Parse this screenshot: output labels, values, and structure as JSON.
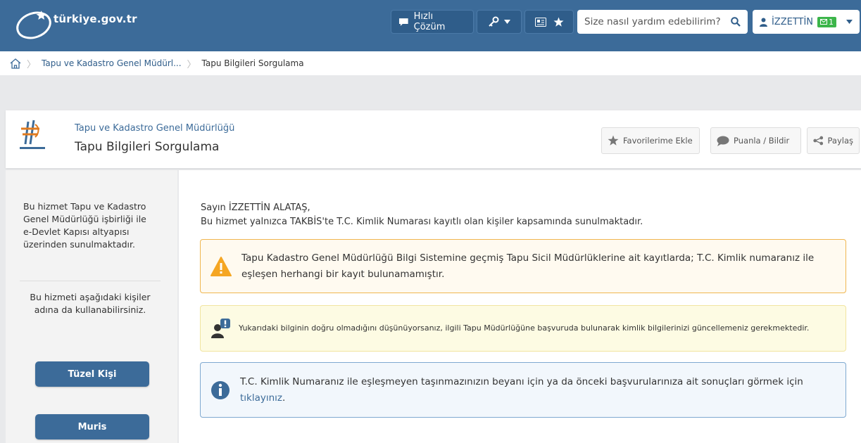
{
  "header": {
    "logo_text": "türkiye.gov.tr",
    "quick_solution_label": "Hızlı Çözüm",
    "search_placeholder": "Size nasıl yardım edebilirim?",
    "user_name": "İZZETTİN",
    "mail_count": "1"
  },
  "breadcrumb": {
    "items": [
      "Tapu ve Kadastro Genel Müdürl...",
      "Tapu Bilgileri Sorgulama"
    ]
  },
  "title_card": {
    "institution": "Tapu ve Kadastro Genel Müdürlüğü",
    "page_title": "Tapu Bilgileri Sorgulama",
    "actions": [
      "Favorilerime Ekle",
      "Puanla / Bildir",
      "Paylaş"
    ]
  },
  "sidebar": {
    "info_text": "Bu hizmet Tapu ve Kadastro Genel Müdürlüğü işbirliği ile e-Devlet Kapısı altyapısı üzerinden sunulmaktadır.",
    "others_text": "Bu hizmeti aşağıdaki kişiler adına da kullanabilirsiniz.",
    "buttons": [
      "Tüzel Kişi",
      "Muris"
    ]
  },
  "main": {
    "greeting": "Sayın İZZETTİN ALATAŞ,",
    "subtitle": "Bu hizmet yalnızca TAKBİS'te T.C. Kimlik Numarası kayıtlı olan kişiler kapsamında sunulmaktadır.",
    "warning_text": "Tapu Kadastro Genel Müdürlüğü Bilgi Sistemine geçmiş Tapu Sicil Müdürlüklerine ait kayıtlarda; T.C. Kimlik numaranız ile eşleşen herhangi bir kayıt bulunamamıştır.",
    "notice_text": "Yukarıdaki bilginin doğru olmadığını düşünüyorsanız, ilgili Tapu Müdürlüğüne başvuruda bulunarak kimlik bilgilerinizi güncellemeniz gerekmektedir.",
    "info_text": "T.C. Kimlik Numaranız ile eşleşmeyen taşınmazınızın beyanı için ya da önceki başvurularınıza ait sonuçları görmek için",
    "info_link": "tıklayınız",
    "info_end": "."
  },
  "colors": {
    "header_bg": "#3c6b99",
    "warning_border": "#f0b64f",
    "warning_icon": "#f5a623",
    "info_border": "#7fa9d0",
    "info_icon": "#3c6b99",
    "button_bg": "#3c6b99",
    "mail_badge": "#3cb54a"
  },
  "icons": [
    "home-icon",
    "chat-icon",
    "key-icon",
    "id-card-icon",
    "star-icon",
    "search-icon",
    "user-icon",
    "mail-icon",
    "share-icon",
    "warning-icon",
    "person-alert-icon",
    "info-icon"
  ]
}
